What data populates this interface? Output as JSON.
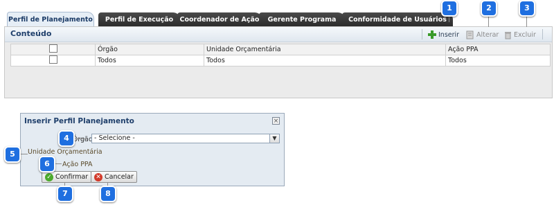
{
  "tabs": [
    {
      "label": "Perfil de Planejamento",
      "active": true
    },
    {
      "label": "Perfil de Execução",
      "active": false
    },
    {
      "label": "Coordenador de Ação",
      "active": false
    },
    {
      "label": "Gerente Programa",
      "active": false
    },
    {
      "label": "Conformidade de Usuários",
      "active": false
    }
  ],
  "panel": {
    "title": "Conteúdo",
    "toolbar": {
      "insert_label": "Inserir",
      "alter_label": "Alterar",
      "delete_label": "Excluir"
    }
  },
  "table": {
    "columns": [
      "",
      "Órgão",
      "Unidade Orçamentária",
      "Ação PPA"
    ],
    "rows": [
      {
        "checked": false,
        "cells": [
          "Todos",
          "Todos",
          "Todos"
        ]
      }
    ]
  },
  "dialog": {
    "title": "Inserir Perfil Planejamento",
    "orgao_label": "Órgão",
    "required_mark": "*",
    "orgao_value": "- Selecione -",
    "unidade_label": "Unidade Orçamentária",
    "acao_label": "Ação PPA",
    "confirm_label": "Confirmar",
    "cancel_label": "Cancelar"
  },
  "markers": [
    "1",
    "2",
    "3",
    "4",
    "5",
    "6",
    "7",
    "8"
  ],
  "colors": {
    "marker": "#1f6fe0",
    "tab_bg": "#2c2c2c",
    "active_tab": "#e6eef6",
    "title": "#1f3f6b"
  },
  "icons": {
    "insert": "plus-icon",
    "alter": "edit-icon",
    "delete": "trash-icon",
    "close": "close-icon",
    "confirm": "check-icon",
    "cancel": "x-icon",
    "dropdown": "chevron-down-icon"
  }
}
